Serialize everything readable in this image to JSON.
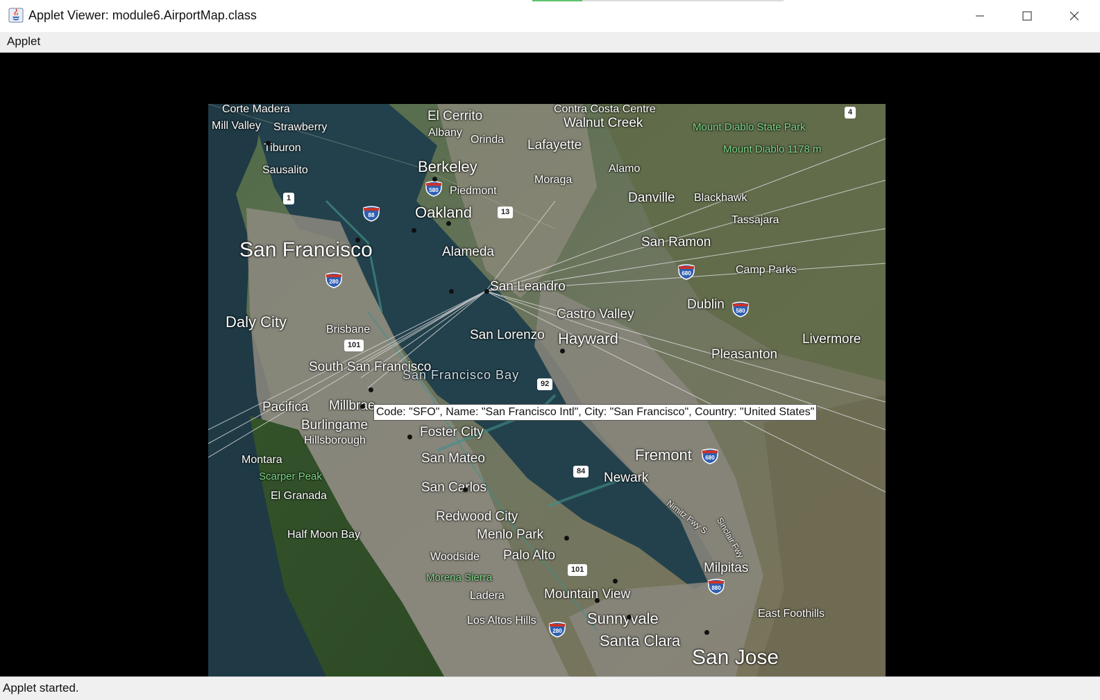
{
  "window": {
    "title": "Applet Viewer: module6.AirportMap.class",
    "controls": {
      "minimize": "minimize-icon",
      "maximize": "maximize-icon",
      "close": "close-icon"
    }
  },
  "menu": {
    "items": [
      {
        "label": "Applet"
      }
    ]
  },
  "map": {
    "places": [
      {
        "text": "Corte Madera"
      },
      {
        "text": "Mill Valley"
      },
      {
        "text": "Strawberry"
      },
      {
        "text": "Tiburon"
      },
      {
        "text": "Sausalito"
      },
      {
        "text": "El Cerrito"
      },
      {
        "text": "Albany"
      },
      {
        "text": "Orinda"
      },
      {
        "text": "Lafayette"
      },
      {
        "text": "Contra Costa Centre"
      },
      {
        "text": "Walnut Creek"
      },
      {
        "text": "Mount Diablo State Park"
      },
      {
        "text": "Mount Diablo 1178 m"
      },
      {
        "text": "Berkeley"
      },
      {
        "text": "Piedmont"
      },
      {
        "text": "Moraga"
      },
      {
        "text": "Alamo"
      },
      {
        "text": "Oakland"
      },
      {
        "text": "Danville"
      },
      {
        "text": "Blackhawk"
      },
      {
        "text": "Tassajara"
      },
      {
        "text": "San Francisco"
      },
      {
        "text": "Alameda"
      },
      {
        "text": "San Ramon"
      },
      {
        "text": "Camp Parks"
      },
      {
        "text": "San Leandro"
      },
      {
        "text": "Dublin"
      },
      {
        "text": "Daly City"
      },
      {
        "text": "Brisbane"
      },
      {
        "text": "Castro Valley"
      },
      {
        "text": "San Lorenzo"
      },
      {
        "text": "Hayward"
      },
      {
        "text": "Livermore"
      },
      {
        "text": "Pleasanton"
      },
      {
        "text": "South San Francisco"
      },
      {
        "text": "San Francisco Bay"
      },
      {
        "text": "Pacifica"
      },
      {
        "text": "Millbrae"
      },
      {
        "text": "Burlingame"
      },
      {
        "text": "Hillsborough"
      },
      {
        "text": "Foster City"
      },
      {
        "text": "Montara"
      },
      {
        "text": "Scarper Peak"
      },
      {
        "text": "El Granada"
      },
      {
        "text": "San Mateo"
      },
      {
        "text": "Fremont"
      },
      {
        "text": "Newark"
      },
      {
        "text": "San Carlos"
      },
      {
        "text": "Redwood City"
      },
      {
        "text": "Half Moon Bay"
      },
      {
        "text": "Menlo Park"
      },
      {
        "text": "Woodside"
      },
      {
        "text": "Palo Alto"
      },
      {
        "text": "Morena Sierra"
      },
      {
        "text": "Milpitas"
      },
      {
        "text": "Ladera"
      },
      {
        "text": "Mountain View"
      },
      {
        "text": "East Foothills"
      },
      {
        "text": "Los Altos Hills"
      },
      {
        "text": "Sunnyvale"
      },
      {
        "text": "Santa Clara"
      },
      {
        "text": "San Jose"
      },
      {
        "text": "Nimitz Fwy S"
      },
      {
        "text": "Sinclair Fwy"
      }
    ],
    "routes": [
      "1",
      "4",
      "13",
      "84",
      "92",
      "101",
      "101"
    ],
    "interstates": [
      "580",
      "88",
      "280",
      "680",
      "580",
      "680",
      "280",
      "880"
    ],
    "tooltip": "Code: \"SFO\", Name: \"San Francisco Intl\", City: \"San Francisco\", Country: \"United States\"",
    "colors": {
      "water": "#1f3a45",
      "land_urban": "#8e8b7e",
      "land_green": "#3b5a2c",
      "land_dry": "#7a6f55"
    }
  },
  "status": {
    "text": "Applet started."
  },
  "title_progress": {
    "fraction": 0.2
  }
}
